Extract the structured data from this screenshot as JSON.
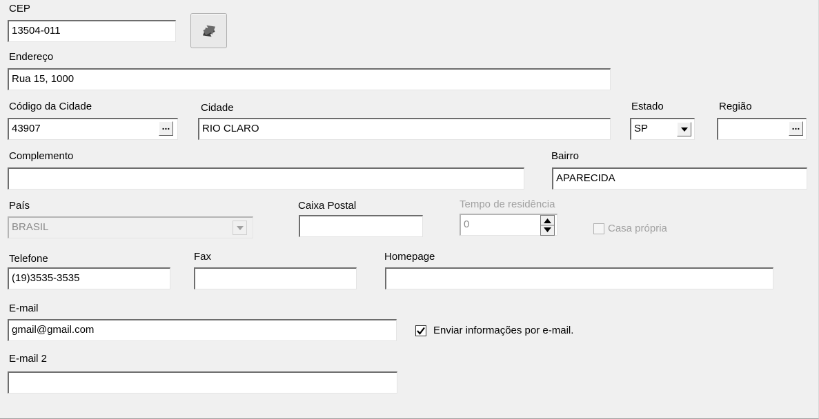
{
  "cep": {
    "label": "CEP",
    "value": "13504-011"
  },
  "endereco": {
    "label": "Endereço",
    "value": "Rua 15, 1000"
  },
  "codigo_cidade": {
    "label": "Código da Cidade",
    "value": "43907"
  },
  "cidade": {
    "label": "Cidade",
    "value": "RIO CLARO"
  },
  "estado": {
    "label": "Estado",
    "value": "SP"
  },
  "regiao": {
    "label": "Região",
    "value": ""
  },
  "complemento": {
    "label": "Complemento",
    "value": ""
  },
  "bairro": {
    "label": "Bairro",
    "value": "APARECIDA"
  },
  "pais": {
    "label": "País",
    "value": "BRASIL"
  },
  "caixa_postal": {
    "label": "Caixa Postal",
    "value": ""
  },
  "tempo_residencia": {
    "label": "Tempo de residência",
    "value": "0"
  },
  "casa_propria": {
    "label": "Casa própria",
    "checked": false
  },
  "telefone": {
    "label": "Telefone",
    "value": "(19)3535-3535"
  },
  "fax": {
    "label": "Fax",
    "value": ""
  },
  "homepage": {
    "label": "Homepage",
    "value": ""
  },
  "email": {
    "label": "E-mail",
    "value": "gmail@gmail.com"
  },
  "enviar_info": {
    "label": "Enviar informações por e-mail.",
    "checked": true
  },
  "email2": {
    "label": "E-mail 2",
    "value": ""
  },
  "ellipsis_glyph": "...",
  "icons": {
    "swap": "swap-arrows-icon",
    "dropdown": "chevron-down-icon",
    "spin_up": "arrow-up-icon",
    "spin_down": "arrow-down-icon",
    "check": "check-icon"
  }
}
